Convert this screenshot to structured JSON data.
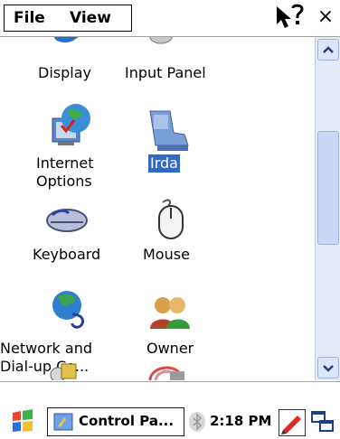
{
  "menubar": {
    "file_label": "File",
    "view_label": "View",
    "close_glyph": "×"
  },
  "items": [
    {
      "label": "Display",
      "icon": "display-icon"
    },
    {
      "label": "Input Panel",
      "icon": "input-panel-icon"
    },
    {
      "label_line1": "Internet",
      "label_line2": "Options",
      "icon": "internet-options-icon"
    },
    {
      "label": "Irda",
      "icon": "irda-icon",
      "selected": true
    },
    {
      "label": "Keyboard",
      "icon": "keyboard-icon"
    },
    {
      "label": "Mouse",
      "icon": "mouse-icon"
    },
    {
      "label_line1": "Network and",
      "label_line2": "Dial-up Co...",
      "icon": "network-icon"
    },
    {
      "label": "Owner",
      "icon": "owner-icon"
    }
  ],
  "taskbar": {
    "app_label": "Control Pa...",
    "clock": "2:18 PM"
  },
  "colors": {
    "selection": "#316ac5",
    "scroll_track": "#e4ebf7",
    "scroll_thumb": "#c7d7f5"
  }
}
